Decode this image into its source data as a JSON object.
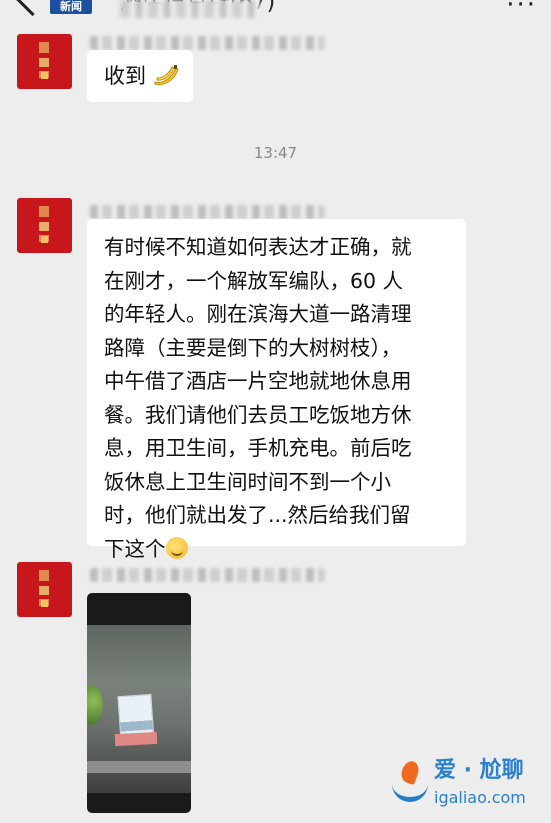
{
  "header": {
    "badge_label": "新闻",
    "title": "酒店信息群(67)",
    "more_glyph": "···"
  },
  "messages": [
    {
      "type": "text",
      "text": "收到",
      "emoji": "banana"
    },
    {
      "type": "timestamp",
      "text": "13:47"
    },
    {
      "type": "text",
      "lines": [
        "有时候不知道如何表达才正确，就",
        "在刚才，一个解放军编队，60 人",
        "的年轻人。刚在滨海大道一路清理",
        "路障（主要是倒下的大树树枝），",
        "中午借了酒店一片空地就地休息用",
        "餐。我们请他们去员工吃饭地方休",
        "息，用卫生间，手机充电。前后吃",
        "饭休息上卫生间时间不到一个小",
        "时，他们就出发了...然后给我们留",
        "下这个"
      ],
      "emoji": "laugh-cry"
    },
    {
      "type": "image",
      "description_icon": "photo"
    }
  ],
  "watermark": {
    "title": "爱 · 尬聊",
    "url": "igaliao.com"
  },
  "colors": {
    "background": "#ededed",
    "bubble": "#ffffff",
    "avatar": "#c8161d",
    "badge": "#1d4fa0",
    "watermark": "#2a7fd0"
  }
}
